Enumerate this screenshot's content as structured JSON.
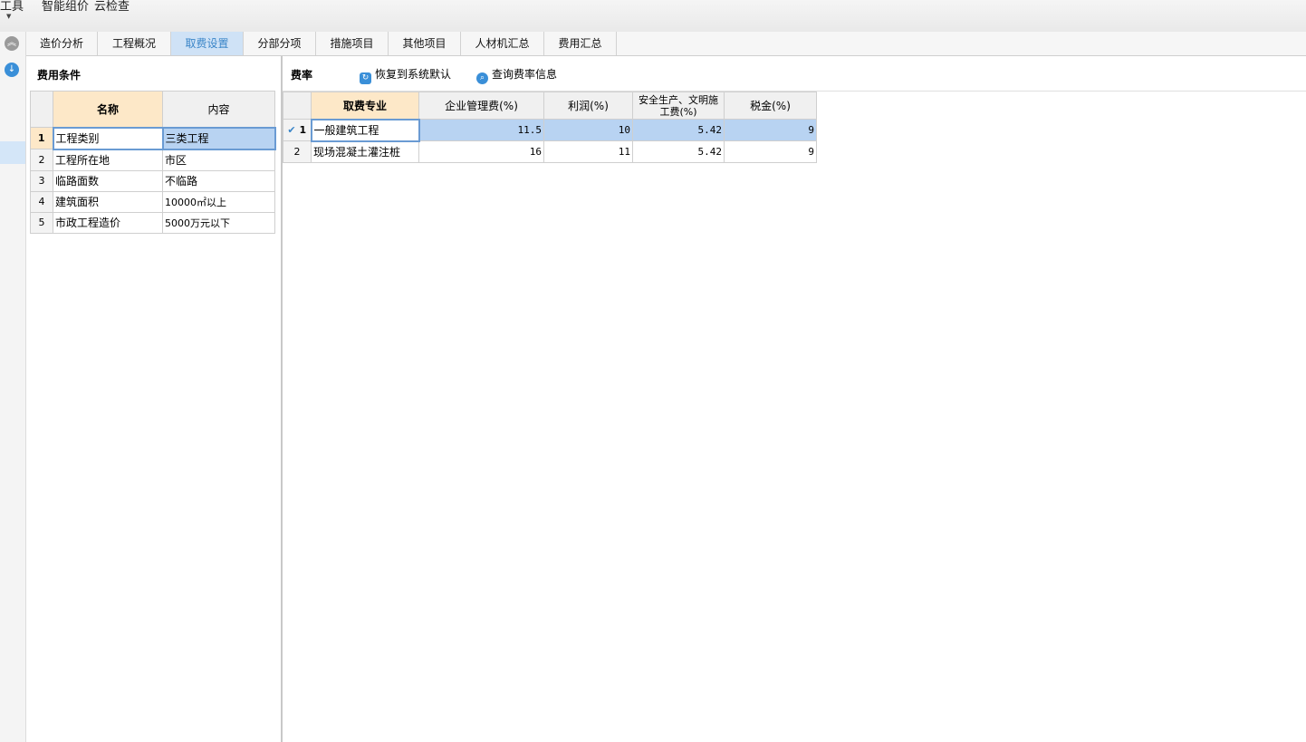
{
  "menu": {
    "tools": "工具",
    "smart_group": "智能组价",
    "cloud_check": "云检查"
  },
  "tabs": [
    {
      "label": "造价分析"
    },
    {
      "label": "工程概况"
    },
    {
      "label": "取费设置",
      "active": true
    },
    {
      "label": "分部分项"
    },
    {
      "label": "措施项目"
    },
    {
      "label": "其他项目"
    },
    {
      "label": "人材机汇总"
    },
    {
      "label": "费用汇总"
    }
  ],
  "left_panel": {
    "title": "费用条件",
    "headers": {
      "name": "名称",
      "content": "内容"
    },
    "rows": [
      {
        "n": "1",
        "name": "工程类别",
        "content": "三类工程"
      },
      {
        "n": "2",
        "name": "工程所在地",
        "content": "市区"
      },
      {
        "n": "3",
        "name": "临路面数",
        "content": "不临路"
      },
      {
        "n": "4",
        "name": "建筑面积",
        "content": "10000㎡以上"
      },
      {
        "n": "5",
        "name": "市政工程造价",
        "content": "5000万元以下"
      }
    ]
  },
  "right_panel": {
    "title": "费率",
    "restore_button": "恢复到系统默认",
    "query_button": "查询费率信息",
    "headers": {
      "specialty": "取费专业",
      "mgmt": "企业管理费(%)",
      "profit": "利润(%)",
      "safety": "安全生产、文明施工费(%)",
      "tax": "税金(%)"
    },
    "rows": [
      {
        "n": "1",
        "specialty": "一般建筑工程",
        "mgmt": "11.5",
        "profit": "10",
        "safety": "5.42",
        "tax": "9"
      },
      {
        "n": "2",
        "specialty": "现场混凝土灌注桩",
        "mgmt": "16",
        "profit": "11",
        "safety": "5.42",
        "tax": "9"
      }
    ]
  },
  "colors": {
    "accent": "#3a85c8",
    "selected_row": "#b8d3f2",
    "header_selected": "#fde8c8"
  }
}
